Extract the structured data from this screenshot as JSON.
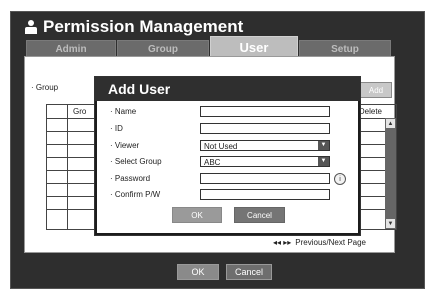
{
  "window": {
    "title": "Permission Management"
  },
  "tabs": [
    {
      "label": "Admin"
    },
    {
      "label": "Group"
    },
    {
      "label": "User"
    },
    {
      "label": "Setup"
    }
  ],
  "panel": {
    "group_label": "· Group",
    "add_label": "Add",
    "columns": {
      "group": "Gro",
      "delete": "Delete"
    },
    "pager_label": "Previous/Next Page",
    "pager_icon": "◂◂ ▸▸"
  },
  "dialog": {
    "title": "Add User",
    "fields": {
      "name_label": "· Name",
      "name_value": "",
      "id_label": "· ID",
      "id_value": "",
      "viewer_label": "· Viewer",
      "viewer_value": "Not Used",
      "group_label": "· Select Group",
      "group_value": "ABC",
      "password_label": "· Password",
      "password_value": "",
      "confirm_label": "· Confirm P/W",
      "confirm_value": ""
    },
    "ok_label": "OK",
    "cancel_label": "Cancel"
  },
  "footer": {
    "ok_label": "OK",
    "cancel_label": "Cancel"
  },
  "colors": {
    "frame_bg": "#2e2e2e",
    "tab_active": "#bdbdbd",
    "tab_inactive": "#6b6b6b",
    "button_gray": "#8a8a8a"
  }
}
